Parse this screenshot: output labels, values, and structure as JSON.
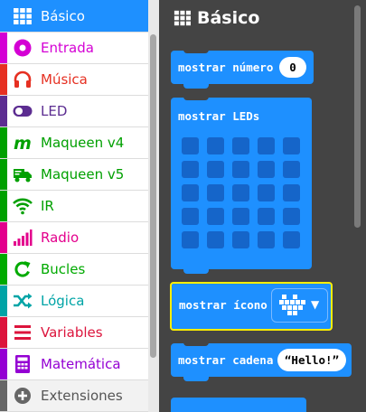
{
  "sidebar": {
    "items": [
      {
        "label": "Básico",
        "icon": "grid-icon",
        "color": "#1e90ff",
        "selected": true
      },
      {
        "label": "Entrada",
        "icon": "circle-dot-icon",
        "color": "#d400d4"
      },
      {
        "label": "Música",
        "icon": "headphones-icon",
        "color": "#e63022"
      },
      {
        "label": "LED",
        "icon": "toggle-icon",
        "color": "#5c2d91"
      },
      {
        "label": "Maqueen v4",
        "icon": "m-letter-icon",
        "color": "#00a000"
      },
      {
        "label": "Maqueen v5",
        "icon": "truck-icon",
        "color": "#00a000"
      },
      {
        "label": "IR",
        "icon": "wifi-icon",
        "color": "#00a000"
      },
      {
        "label": "Radio",
        "icon": "signal-bars-icon",
        "color": "#e3008c"
      },
      {
        "label": "Bucles",
        "icon": "refresh-icon",
        "color": "#00aa00"
      },
      {
        "label": "Lógica",
        "icon": "shuffle-icon",
        "color": "#00a4a6"
      },
      {
        "label": "Variables",
        "icon": "list-icon",
        "color": "#dc143c"
      },
      {
        "label": "Matemática",
        "icon": "calculator-icon",
        "color": "#9400d3"
      },
      {
        "label": "Extensiones",
        "icon": "plus-circle-icon",
        "color": "#666666"
      }
    ]
  },
  "flyout": {
    "title": "Básico",
    "blocks": {
      "show_number": {
        "label": "mostrar número",
        "value": "0"
      },
      "show_leds": {
        "label": "mostrar LEDs"
      },
      "show_icon": {
        "label": "mostrar ícono"
      },
      "show_string": {
        "label": "mostrar cadena",
        "value": "Hello!"
      }
    }
  },
  "colors": {
    "block": "#1e90ff",
    "led_off": "#1565c9",
    "highlight": "#ffee00"
  }
}
